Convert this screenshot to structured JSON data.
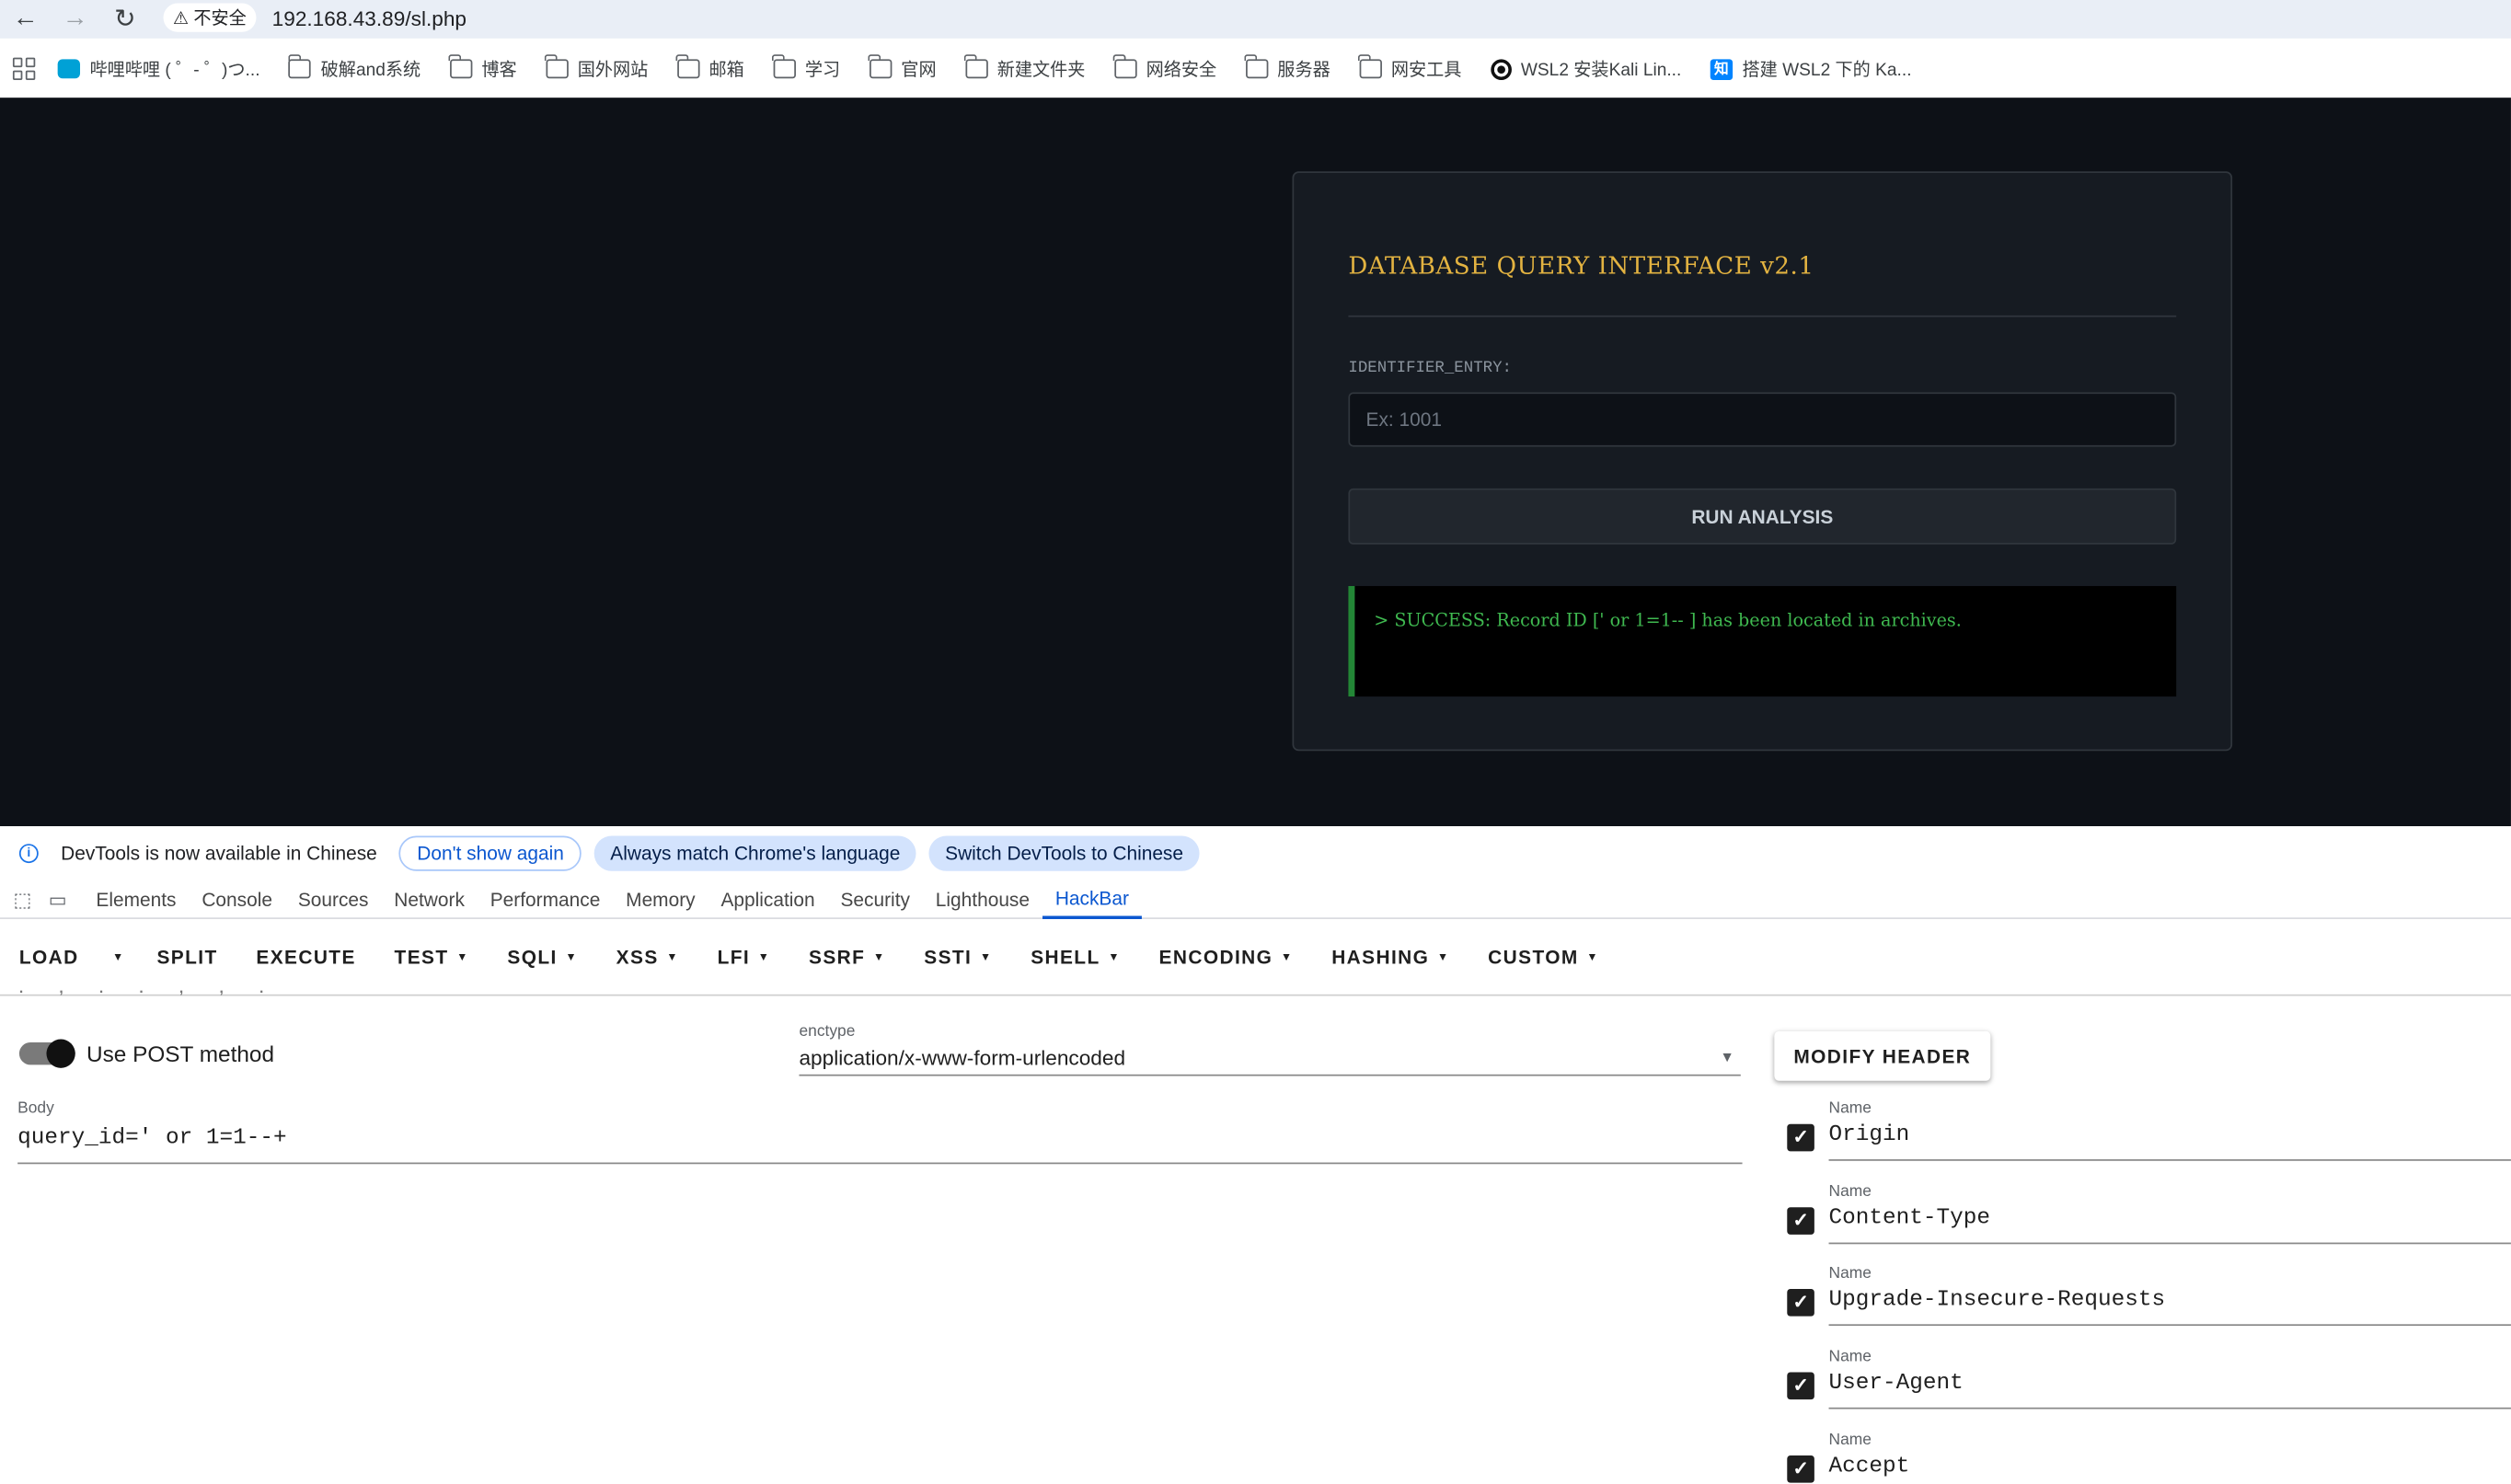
{
  "browser": {
    "security_label": "不安全",
    "url": "192.168.43.89/sl.php",
    "bookmarks": [
      {
        "label": "哔哩哔哩 ( ゜- ゜)つ...",
        "icon": "bilibili-icon"
      },
      {
        "label": "破解and系统",
        "icon": "folder-icon"
      },
      {
        "label": "博客",
        "icon": "folder-icon"
      },
      {
        "label": "国外网站",
        "icon": "folder-icon"
      },
      {
        "label": "邮箱",
        "icon": "folder-icon"
      },
      {
        "label": "学习",
        "icon": "folder-icon"
      },
      {
        "label": "官网",
        "icon": "folder-icon"
      },
      {
        "label": "新建文件夹",
        "icon": "folder-icon"
      },
      {
        "label": "网络安全",
        "icon": "folder-icon"
      },
      {
        "label": "服务器",
        "icon": "folder-icon"
      },
      {
        "label": "网安工具",
        "icon": "folder-icon"
      },
      {
        "label": "WSL2 安装Kali Lin...",
        "icon": "github-icon"
      },
      {
        "label": "搭建 WSL2 下的 Ka...",
        "icon": "zhihu-icon"
      }
    ]
  },
  "page": {
    "title": "DATABASE QUERY INTERFACE v2.1",
    "field_label": "IDENTIFIER_ENTRY:",
    "input_placeholder": "Ex: 1001",
    "button_label": "RUN ANALYSIS",
    "result_text": "> SUCCESS: Record ID [' or 1=1-- ] has been located in archives."
  },
  "devtools": {
    "banner": {
      "message": "DevTools is now available in Chinese",
      "dont_show": "Don't show again",
      "always_match": "Always match Chrome's language",
      "switch": "Switch DevTools to Chinese"
    },
    "tabs": [
      "Elements",
      "Console",
      "Sources",
      "Network",
      "Performance",
      "Memory",
      "Application",
      "Security",
      "Lighthouse",
      "HackBar"
    ],
    "active_tab": "HackBar"
  },
  "hackbar": {
    "toolbar": [
      "LOAD",
      "SPLIT",
      "EXECUTE",
      "TEST",
      "SQLI",
      "XSS",
      "LFI",
      "SSRF",
      "SSTI",
      "SHELL",
      "ENCODING",
      "HASHING",
      "CUSTOM"
    ],
    "post_method_label": "Use POST method",
    "post_method_enabled": true,
    "enctype_caption": "enctype",
    "enctype_value": "application/x-www-form-urlencoded",
    "body_caption": "Body",
    "body_value": "query_id=' or 1=1--+",
    "modify_header_label": "MODIFY HEADER",
    "header_caption": "Name",
    "headers": [
      {
        "name": "Origin",
        "checked": true
      },
      {
        "name": "Content-Type",
        "checked": true
      },
      {
        "name": "Upgrade-Insecure-Requests",
        "checked": true
      },
      {
        "name": "User-Agent",
        "checked": true
      },
      {
        "name": "Accept",
        "checked": true
      }
    ]
  },
  "colors": {
    "page_bg": "#0d1117",
    "card_bg": "#161b22",
    "title": "#e3b341",
    "success": "#3fb950",
    "devtools_active": "#0b57d0"
  }
}
